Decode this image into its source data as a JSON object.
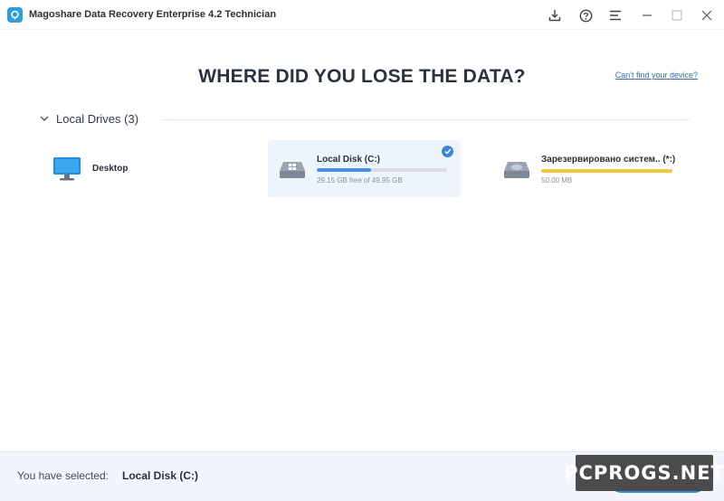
{
  "window": {
    "title": "Magoshare Data Recovery Enterprise 4.2 Technician",
    "buttons": [
      "download-icon",
      "help-icon",
      "menu-icon",
      "minimize-icon",
      "maximize-icon",
      "close-icon"
    ]
  },
  "main": {
    "heading": "WHERE DID YOU LOSE THE DATA?",
    "cant_find_link": "Can't find your device?"
  },
  "section": {
    "title": "Local Drives (3)",
    "expanded": true
  },
  "drives": [
    {
      "name": "Desktop",
      "icon": "monitor-icon",
      "selected": false
    },
    {
      "name": "Local Disk (C:)",
      "icon": "windows-disk-icon",
      "free_text": "29.15 GB free of 49.95 GB",
      "used_fraction": 0.42,
      "bar_color": "#4f8fe0",
      "selected": true
    },
    {
      "name": "Зарезервировано систем.. (*:)",
      "icon": "disk-icon",
      "free_text": "50.00 MB",
      "used_fraction": 1.0,
      "bar_color": "#f1c93a",
      "selected": false
    }
  ],
  "footer": {
    "selected_label": "You have selected:",
    "selected_value": "Local Disk (C:)"
  },
  "watermark": {
    "text": "PCPROGS.NET"
  },
  "colors": {
    "accent": "#3a86d8",
    "heading": "#2a3240",
    "footer_bg": "#f2f6fc"
  }
}
